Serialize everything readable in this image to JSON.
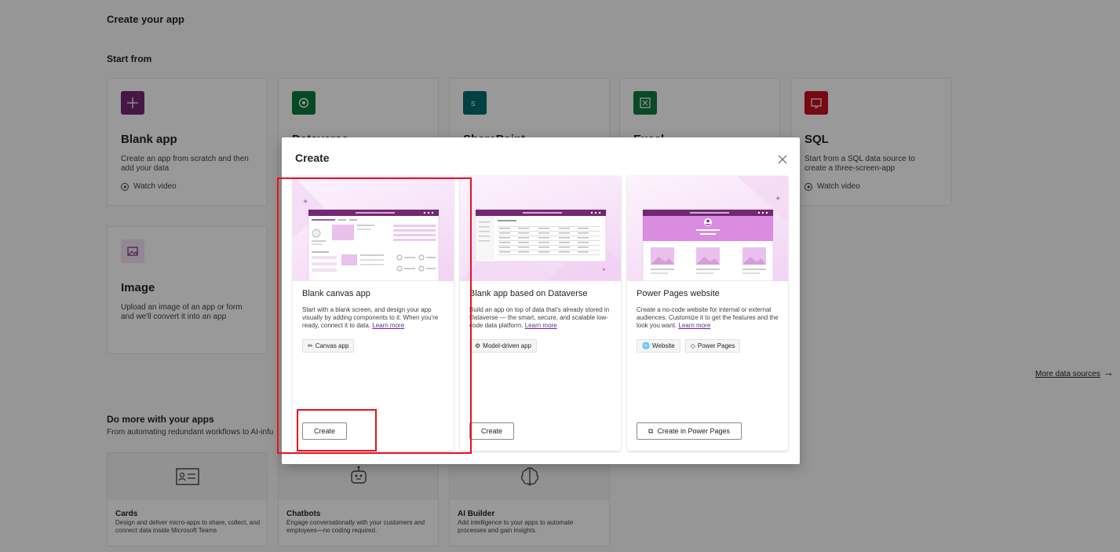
{
  "page": {
    "title": "Create your app",
    "start_from": "Start from"
  },
  "sources": [
    {
      "name": "Blank app",
      "desc": "Create an app from scratch and then add your data",
      "watch": "Watch video",
      "icon": "plus-icon",
      "color": "#742774"
    },
    {
      "name": "Dataverse",
      "desc": "",
      "watch": "",
      "icon": "dataverse-icon",
      "color": "#0b7a3e"
    },
    {
      "name": "SharePoint",
      "desc": "",
      "watch": "",
      "icon": "sharepoint-icon",
      "color": "#036c70"
    },
    {
      "name": "Excel",
      "desc": "",
      "watch": "",
      "icon": "excel-icon",
      "color": "#107c41"
    },
    {
      "name": "SQL",
      "desc": "Start from a SQL data source to create a three-screen-app",
      "watch": "Watch video",
      "icon": "sql-icon",
      "color": "#c50f1f"
    },
    {
      "name": "Image",
      "desc": "Upload an image of an app or form and we'll convert it into an app",
      "watch": "",
      "icon": "image-icon",
      "color": "#f6e1f7"
    }
  ],
  "more_sources": "More data sources",
  "do_more": {
    "title": "Do more with your apps",
    "subtitle": "From automating redundant workflows to AI-infu",
    "cards": [
      {
        "name": "Cards",
        "desc": "Design and deliver micro-apps to share, collect, and connect data inside Microsoft Teams",
        "icon": "card-icon"
      },
      {
        "name": "Chatbots",
        "desc": "Engage conversationally with your customers and employees—no coding required.",
        "icon": "bot-icon"
      },
      {
        "name": "AI Builder",
        "desc": "Add intelligence to your apps to automate processes and gain insights.",
        "icon": "brain-icon"
      }
    ]
  },
  "dialog": {
    "title": "Create",
    "options": [
      {
        "name": "Blank canvas app",
        "desc": "Start with a blank screen, and design your app visually by adding components to it. When you're ready, connect it to data.",
        "learn": "Learn more",
        "tags": [
          "Canvas app"
        ],
        "button": "Create"
      },
      {
        "name": "Blank app based on Dataverse",
        "desc": "Build an app on top of data that's already stored in Dataverse — the smart, secure, and scalable low-code data platform.",
        "learn": "Learn more",
        "tags": [
          "Model-driven app"
        ],
        "button": "Create"
      },
      {
        "name": "Power Pages website",
        "desc": "Create a no-code website for internal or external audiences. Customize it to get the features and the look you want.",
        "learn": "Learn more",
        "tags": [
          "Website",
          "Power Pages"
        ],
        "button": "Create in Power Pages"
      }
    ]
  }
}
